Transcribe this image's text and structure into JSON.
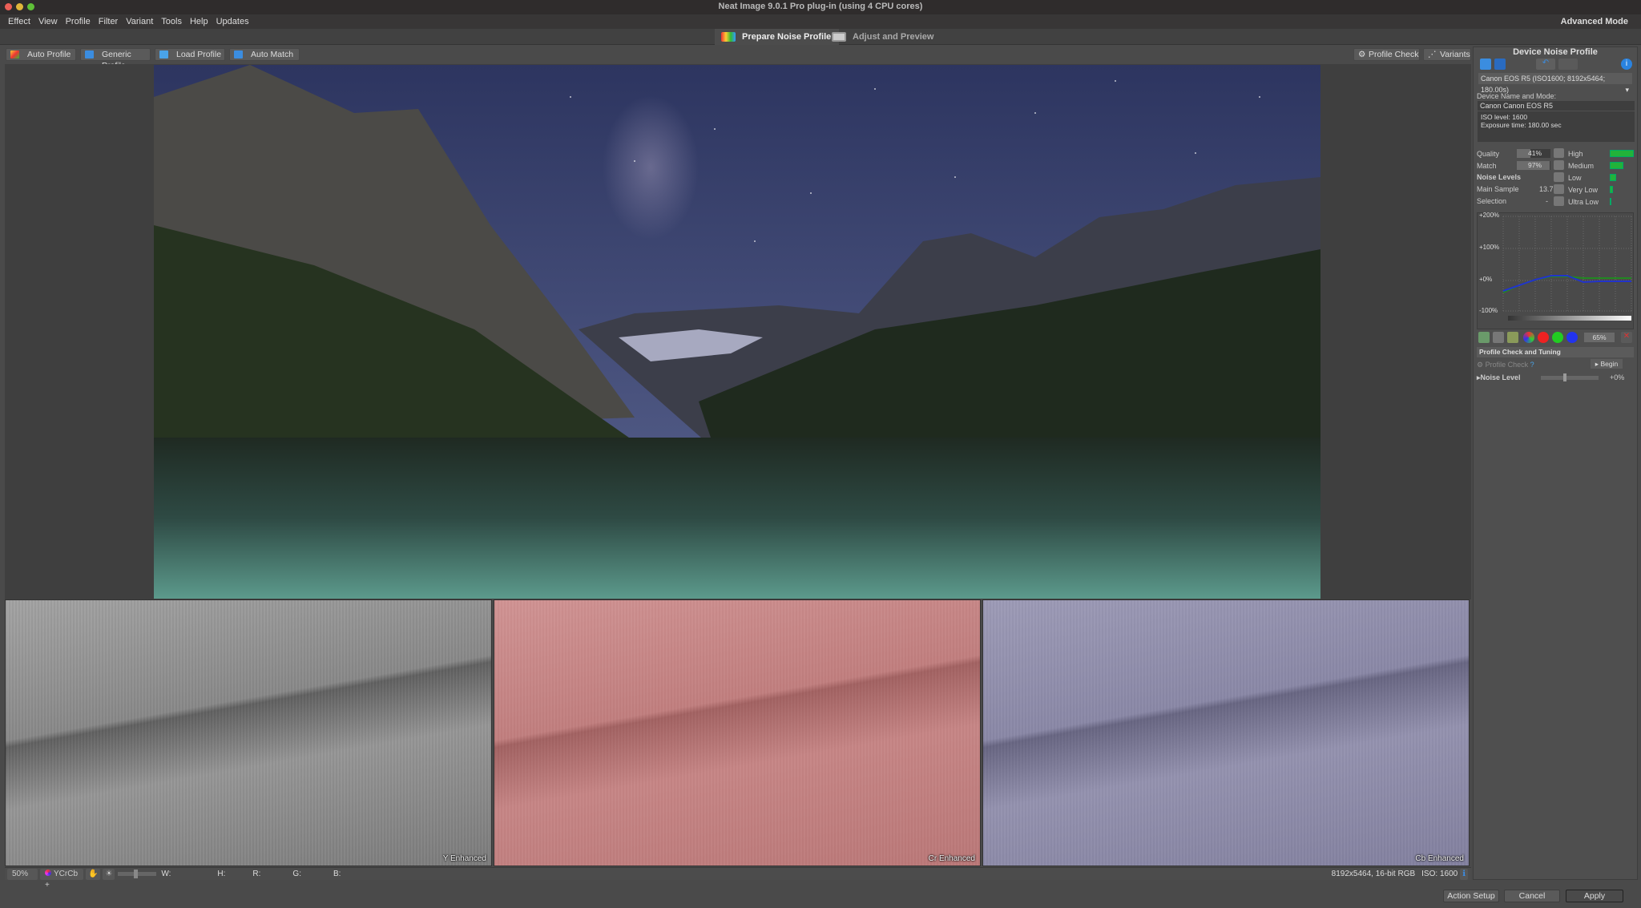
{
  "window": {
    "title": "Neat Image 9.0.1 Pro plug-in (using 4 CPU cores)",
    "mode": "Advanced Mode"
  },
  "menu": [
    "Effect",
    "View",
    "Profile",
    "Filter",
    "Variant",
    "Tools",
    "Help",
    "Updates"
  ],
  "tabs": [
    {
      "label": "Prepare Noise Profile",
      "active": true
    },
    {
      "label": "Adjust and Preview",
      "active": false
    }
  ],
  "toolbar": {
    "auto_profile": "Auto Profile",
    "generic_profile": "Generic Profile",
    "load_profile": "Load Profile",
    "auto_match": "Auto Match",
    "profile_check": "Profile Check",
    "variants": "Variants"
  },
  "panels": [
    {
      "label": "Y Enhanced"
    },
    {
      "label": "Cr Enhanced"
    },
    {
      "label": "Cb Enhanced"
    }
  ],
  "statusbar": {
    "zoom": "50%",
    "colorspace": "YCrCb +",
    "w": "W:",
    "h": "H:",
    "r": "R:",
    "g": "G:",
    "b": "B:",
    "image_info": "8192x5464, 16-bit RGB",
    "iso": "ISO: 1600"
  },
  "profile": {
    "title": "Device Noise Profile",
    "selected": "Canon EOS R5 (ISO1600; 8192x5464; 180.00s)",
    "device_label": "Device Name and Mode:",
    "device_name": "Canon Canon EOS R5",
    "info_line1": "ISO level: 1600",
    "info_line2": "Exposure time: 180.00 sec",
    "quality_label": "Quality",
    "quality": "41%",
    "quality_pct": 41,
    "match_label": "Match",
    "match": "97%",
    "match_pct": 97,
    "noise_levels_label": "Noise Levels",
    "main_sample_label": "Main Sample",
    "main_sample": "13.7",
    "selection_label": "Selection",
    "selection": "-",
    "levels": [
      {
        "name": "High",
        "pct": 100
      },
      {
        "name": "Medium",
        "pct": 55
      },
      {
        "name": "Low",
        "pct": 27
      },
      {
        "name": "Very Low",
        "pct": 12
      },
      {
        "name": "Ultra Low",
        "pct": 5
      }
    ],
    "graph_ticks": [
      "+200%",
      "+100%",
      "+0%",
      "-100%"
    ],
    "graph_percent": "65%",
    "tuning_title": "Profile Check and Tuning",
    "profile_check": "Profile Check",
    "begin": "Begin",
    "noise_level_label": "Noise Level",
    "noise_level_value": "+0%"
  },
  "buttons": {
    "action_setup": "Action Setup",
    "cancel": "Cancel",
    "apply": "Apply"
  }
}
